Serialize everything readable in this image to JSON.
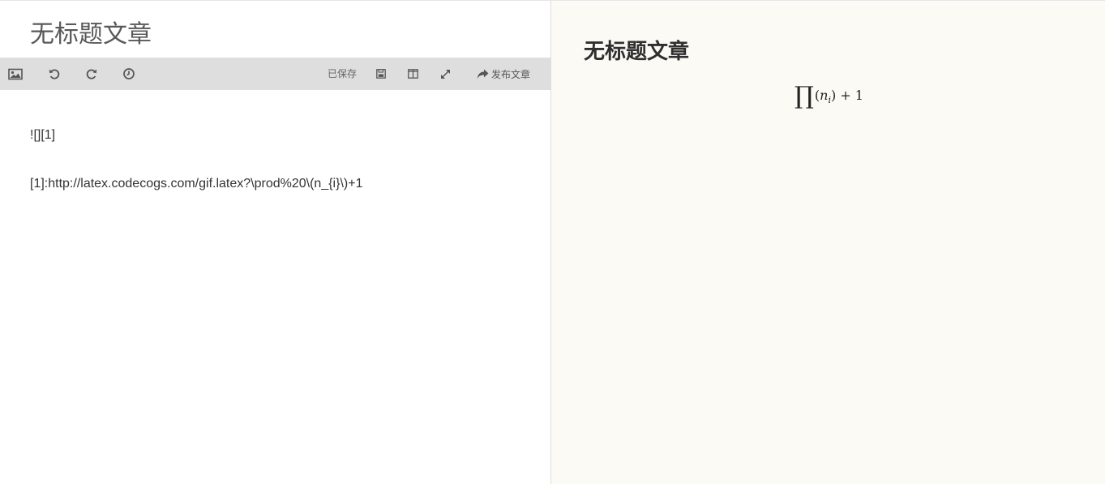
{
  "editor": {
    "title": "无标题文章",
    "toolbar": {
      "image_icon": "image-icon",
      "undo_icon": "undo-icon",
      "redo_icon": "redo-icon",
      "history_icon": "clock-icon",
      "saved_label": "已保存",
      "save_icon": "floppy-icon",
      "split_view_icon": "columns-icon",
      "fullscreen_icon": "expand-icon",
      "publish_label": "发布文章",
      "publish_icon": "share-arrow-icon"
    },
    "content_lines": [
      "![][1]",
      "[1]:http://latex.codecogs.com/gif.latex?\\prod%20\\(n_{i}\\)+1"
    ]
  },
  "preview": {
    "title": "无标题文章",
    "formula": {
      "operator": "∏",
      "base": "n",
      "subscript": "i",
      "suffix": "+ 1"
    }
  },
  "colors": {
    "toolbar_bg": "#dedede",
    "preview_bg": "#fcfaf5",
    "title_text": "#595959"
  }
}
